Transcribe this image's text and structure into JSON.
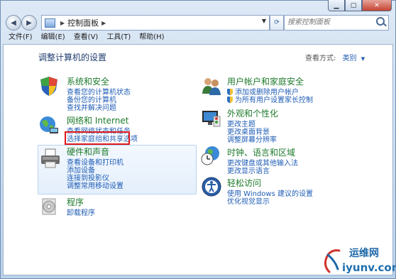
{
  "address": {
    "crumb": "控制面板",
    "separator": "▶"
  },
  "search": {
    "placeholder": "搜索控制面板"
  },
  "menu": [
    "文件(F)",
    "编辑(E)",
    "查看(V)",
    "工具(T)",
    "帮助(H)"
  ],
  "heading": "调整计算机的设置",
  "view_by": {
    "label": "查看方式:",
    "value": "类别"
  },
  "left_categories": [
    {
      "title": "系统和安全",
      "links": [
        "查看您的计算机状态",
        "备份您的计算机",
        "查找并解决问题"
      ]
    },
    {
      "title": "网络和 Internet",
      "links": [
        "查看网络状态和任务",
        "选择家庭组和共享选项"
      ]
    },
    {
      "title": "硬件和声音",
      "links": [
        "查看设备和打印机",
        "添加设备",
        "连接到投影仪",
        "调整常用移动设置"
      ]
    },
    {
      "title": "程序",
      "links": [
        "卸载程序"
      ]
    }
  ],
  "right_categories": [
    {
      "title": "用户帐户和家庭安全",
      "links": [
        "添加或删除用户帐户",
        "为所有用户设置家长控制"
      ]
    },
    {
      "title": "外观和个性化",
      "links": [
        "更改主题",
        "更改桌面背景",
        "调整屏幕分辨率"
      ]
    },
    {
      "title": "时钟、语言和区域",
      "links": [
        "更改键盘或其他输入法",
        "更改显示语言"
      ]
    },
    {
      "title": "轻松访问",
      "links": [
        "使用 Windows 建议的设置",
        "优化视觉显示"
      ]
    }
  ],
  "watermark": {
    "name": "运维网",
    "domain": "iyunv.com"
  },
  "colors": {
    "link": "#1f5db5",
    "category": "#1e7b2c",
    "highlight": "#e0171b"
  }
}
